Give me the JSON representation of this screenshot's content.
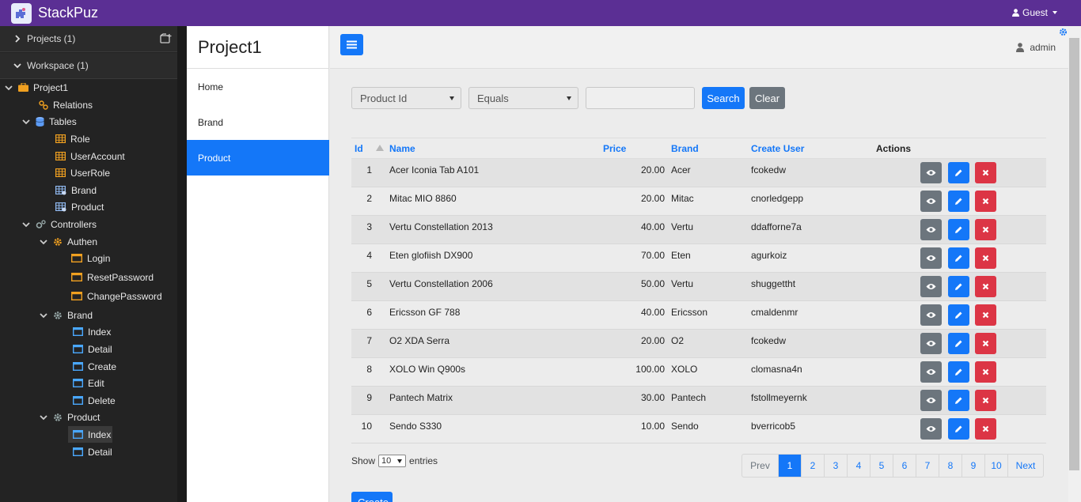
{
  "app": {
    "title": "StackPuz",
    "user_menu": "Guest"
  },
  "tree": {
    "projects_header": "Projects (1)",
    "workspace_header": "Workspace (1)",
    "project": "Project1",
    "relations": "Relations",
    "tables": "Tables",
    "table_items": [
      "Role",
      "UserAccount",
      "UserRole",
      "Brand",
      "Product"
    ],
    "controllers": "Controllers",
    "authen": "Authen",
    "authen_items": [
      "Login",
      "ResetPassword",
      "ChangePassword"
    ],
    "brand": "Brand",
    "brand_items": [
      "Index",
      "Detail",
      "Create",
      "Edit",
      "Delete"
    ],
    "product": "Product",
    "product_items": [
      "Index",
      "Detail"
    ]
  },
  "nav": {
    "project_title": "Project1",
    "items": [
      "Home",
      "Brand",
      "Product"
    ],
    "active": "Product"
  },
  "header": {
    "user": "admin"
  },
  "search": {
    "field": "Product Id",
    "operator": "Equals",
    "value": "",
    "search_label": "Search",
    "clear_label": "Clear"
  },
  "table": {
    "columns": {
      "id": "Id",
      "name": "Name",
      "price": "Price",
      "brand": "Brand",
      "user": "Create User",
      "actions": "Actions"
    },
    "rows": [
      {
        "id": "1",
        "name": "Acer Iconia Tab A101",
        "price": "20.00",
        "brand": "Acer",
        "user": "fcokedw"
      },
      {
        "id": "2",
        "name": "Mitac MIO 8860",
        "price": "20.00",
        "brand": "Mitac",
        "user": "cnorledgepp"
      },
      {
        "id": "3",
        "name": "Vertu Constellation 2013",
        "price": "40.00",
        "brand": "Vertu",
        "user": "ddafforne7a"
      },
      {
        "id": "4",
        "name": "Eten glofiish DX900",
        "price": "70.00",
        "brand": "Eten",
        "user": "agurkoiz"
      },
      {
        "id": "5",
        "name": "Vertu Constellation 2006",
        "price": "50.00",
        "brand": "Vertu",
        "user": "shuggettht"
      },
      {
        "id": "6",
        "name": "Ericsson GF 788",
        "price": "40.00",
        "brand": "Ericsson",
        "user": "cmaldenmr"
      },
      {
        "id": "7",
        "name": "O2 XDA Serra",
        "price": "20.00",
        "brand": "O2",
        "user": "fcokedw"
      },
      {
        "id": "8",
        "name": "XOLO Win Q900s",
        "price": "100.00",
        "brand": "XOLO",
        "user": "clomasna4n"
      },
      {
        "id": "9",
        "name": "Pantech Matrix",
        "price": "30.00",
        "brand": "Pantech",
        "user": "fstollmeyernk"
      },
      {
        "id": "10",
        "name": "Sendo S330",
        "price": "10.00",
        "brand": "Sendo",
        "user": "bverricob5"
      }
    ]
  },
  "footer": {
    "show_label": "Show",
    "page_size": "10",
    "entries_label": "entries",
    "prev": "Prev",
    "next": "Next",
    "pages": [
      "1",
      "2",
      "3",
      "4",
      "5",
      "6",
      "7",
      "8",
      "9",
      "10"
    ],
    "current_page": "1",
    "create_label": "Create"
  },
  "colors": {
    "topbar": "#5b2f94",
    "primary": "#1477f8",
    "danger": "#dc3545",
    "secondary": "#6c757d",
    "tree_bg": "#232323",
    "tree_icon_orange": "#f0a020",
    "tree_icon_blue": "#4aa8ff"
  }
}
